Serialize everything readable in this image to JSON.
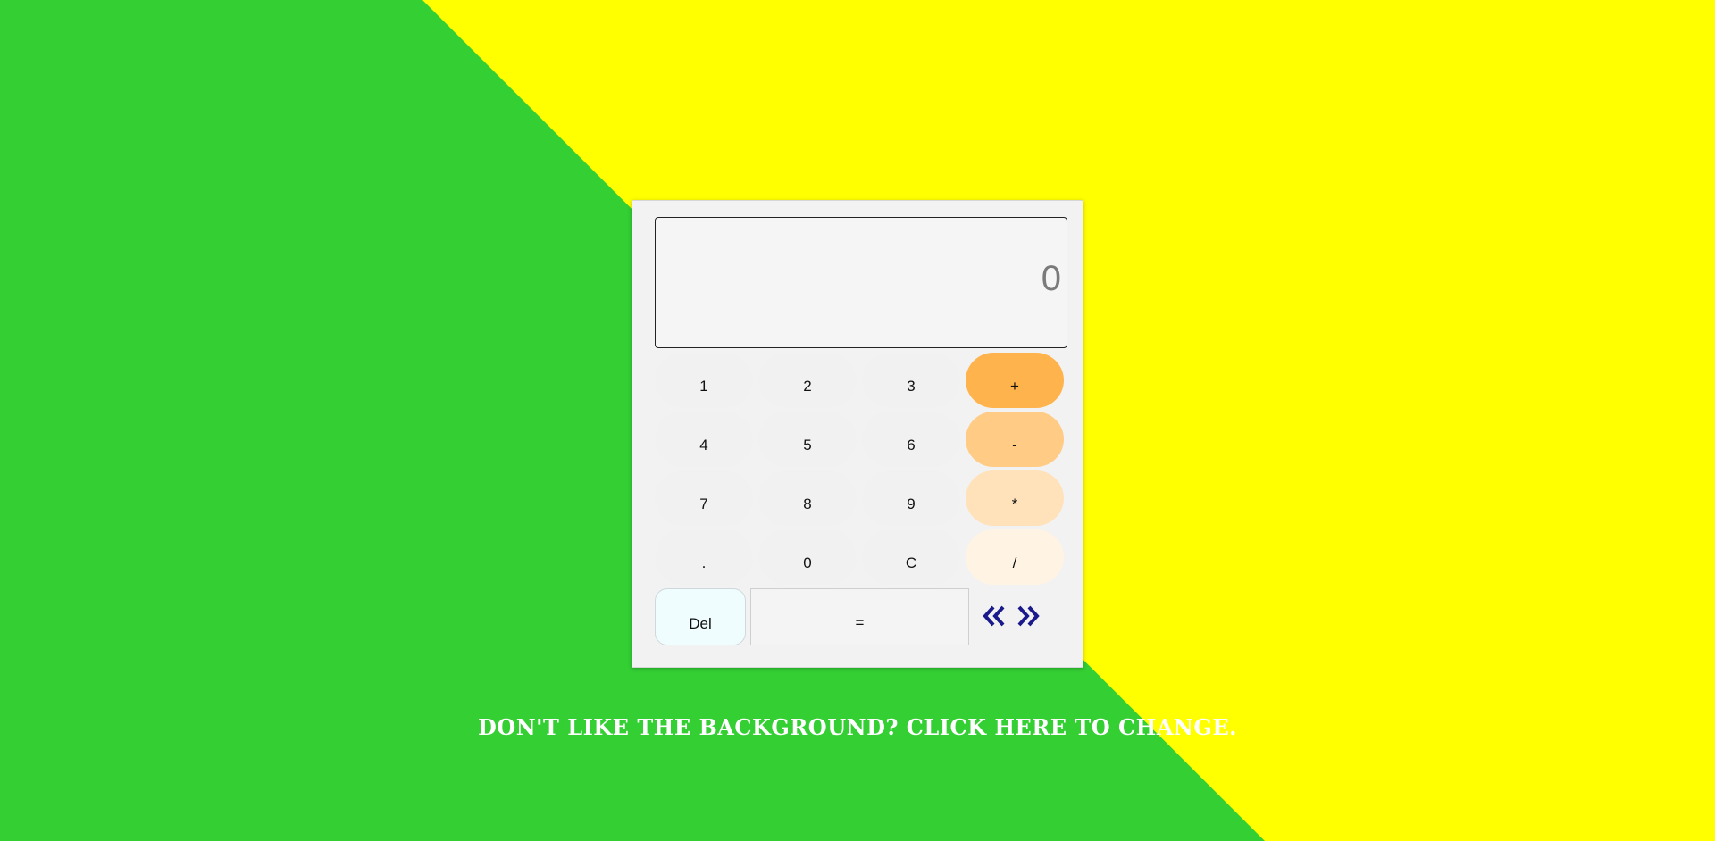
{
  "colors": {
    "background_green": "#33cf33",
    "background_yellow": "#ffff00",
    "plus": "#ffb34d",
    "minus": "#ffcb85",
    "multiply": "#ffe2ba",
    "divide": "#fff3e3",
    "arrow": "#1a1a8c"
  },
  "display": {
    "value": "0"
  },
  "keys": {
    "k1": "1",
    "k2": "2",
    "k3": "3",
    "plus": "+",
    "k4": "4",
    "k5": "5",
    "k6": "6",
    "minus": "-",
    "k7": "7",
    "k8": "8",
    "k9": "9",
    "multiply": "*",
    "dot": ".",
    "k0": "0",
    "clear": "C",
    "divide": "/"
  },
  "controls": {
    "del_label": "Del",
    "equals_label": "=",
    "prev_icon": "double-chevron-left-icon",
    "next_icon": "double-chevron-right-icon"
  },
  "footer": {
    "change_background_text": "Don't like the background? Click here to change."
  }
}
